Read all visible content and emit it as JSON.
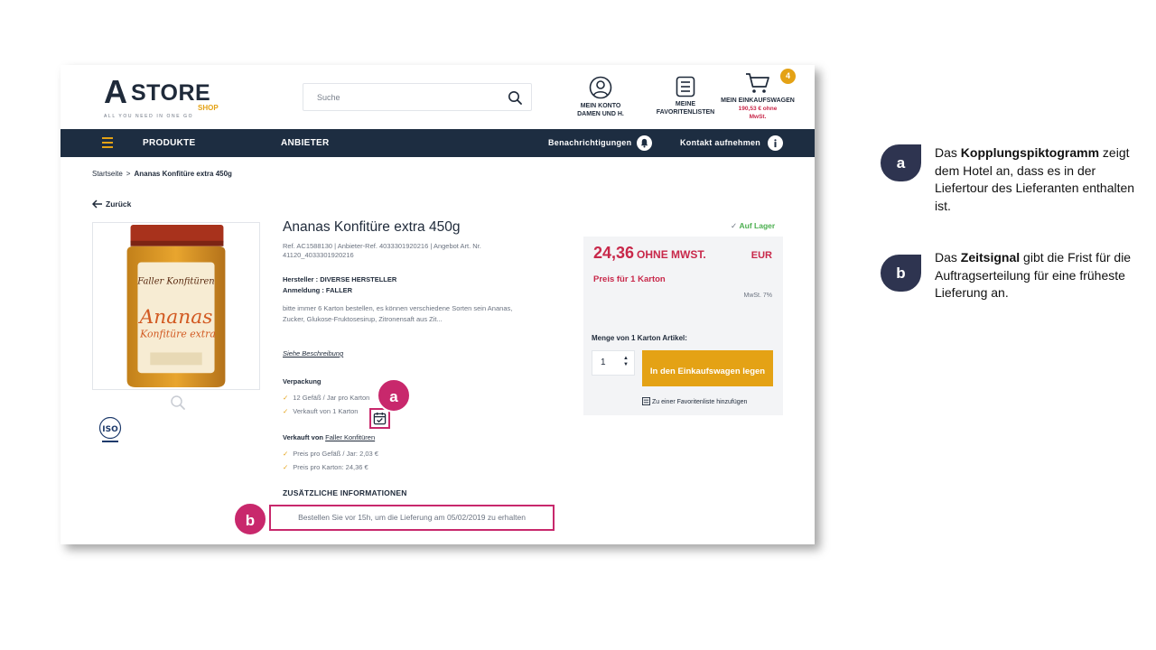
{
  "logo": {
    "letter": "A",
    "word": "STORE",
    "sub": "SHOP",
    "tagline": "ALL YOU NEED IN ONE GO"
  },
  "search": {
    "placeholder": "Suche"
  },
  "header": {
    "account_line1": "MEIN KONTO",
    "account_line2": "DAMEN UND H.",
    "favs_line1": "MEINE",
    "favs_line2": "FAVORITENLISTEN",
    "cart_label": "MEIN EINKAUFSWAGEN",
    "cart_price_line1": "190,53 € ohne",
    "cart_price_line2": "MwSt.",
    "cart_count": "4"
  },
  "nav": {
    "products": "PRODUKTE",
    "vendors": "ANBIETER",
    "notifications": "Benachrichtigungen",
    "contact": "Kontakt aufnehmen"
  },
  "breadcrumb": {
    "home": "Startseite",
    "separator": ">",
    "current": "Ananas Konfitüre extra 450g"
  },
  "back_label": "Zurück",
  "product": {
    "title": "Ananas Konfitüre extra 450g",
    "refs": "Ref. AC1588130 | Anbieter-Ref. 4033301920216 | Angebot Art. Nr. 41120_4033301920216",
    "maker": "Hersteller : DIVERSE HERSTELLER",
    "brand": "Anmeldung : FALLER",
    "description": "bitte immer 6 Karton bestellen, es können verschiedene Sorten sein Ananas, Zucker, Glukose-Fruktosesirup, Zitronensaft aus Zit...",
    "more_link": "Siehe Beschreibung",
    "jar_brand": "Faller Konfitüren",
    "jar_name": "Ananas",
    "jar_sub": "Konfitüre extra",
    "iso": "ISO"
  },
  "packaging": {
    "label": "Verpackung",
    "line1": "12 Gefäß / Jar pro Karton",
    "line2": "Verkauft von 1 Karton"
  },
  "seller": {
    "prefix": "Verkauft von",
    "name": "Faller Konfitüren",
    "price_jar": "Preis pro Gefäß / Jar: 2,03 €",
    "price_carton": "Preis pro Karton: 24,36 €"
  },
  "extra_info": "ZUSÄTZLICHE INFORMATIONEN",
  "deadline": "Bestellen Sie vor 15h, um die Lieferung am 05/02/2019 zu erhalten",
  "stock": "Auf Lager",
  "buy": {
    "price": "24,36",
    "price_unit": "OHNE MWST.",
    "currency": "EUR",
    "per": "Preis für 1 Karton",
    "vat": "MwSt. 7%",
    "qty_label": "Menge von 1 Karton Artikel:",
    "qty_value": "1",
    "add_button": "In den Einkaufswagen legen",
    "fav_add": "Zu einer Favoritenliste hinzufügen"
  },
  "markers": {
    "a": "a",
    "b": "b"
  },
  "legend": {
    "a_badge": "a",
    "a_pre": "Das ",
    "a_term": "Kopplungspiktogramm",
    "a_post": " zeigt dem Hotel an, dass es in der Liefertour des Lieferanten enthalten ist.",
    "b_badge": "b",
    "b_pre": "Das ",
    "b_term": "Zeitsignal",
    "b_post": " gibt die Frist für die Auftragserteilung für eine früheste Lieferung an."
  },
  "colors": {
    "navy": "#1d2d41",
    "accent": "#e4a215",
    "price_red": "#c8284a",
    "marker_pink": "#c8286c",
    "legend_pill": "#2e3450",
    "in_stock": "#4caf50"
  }
}
